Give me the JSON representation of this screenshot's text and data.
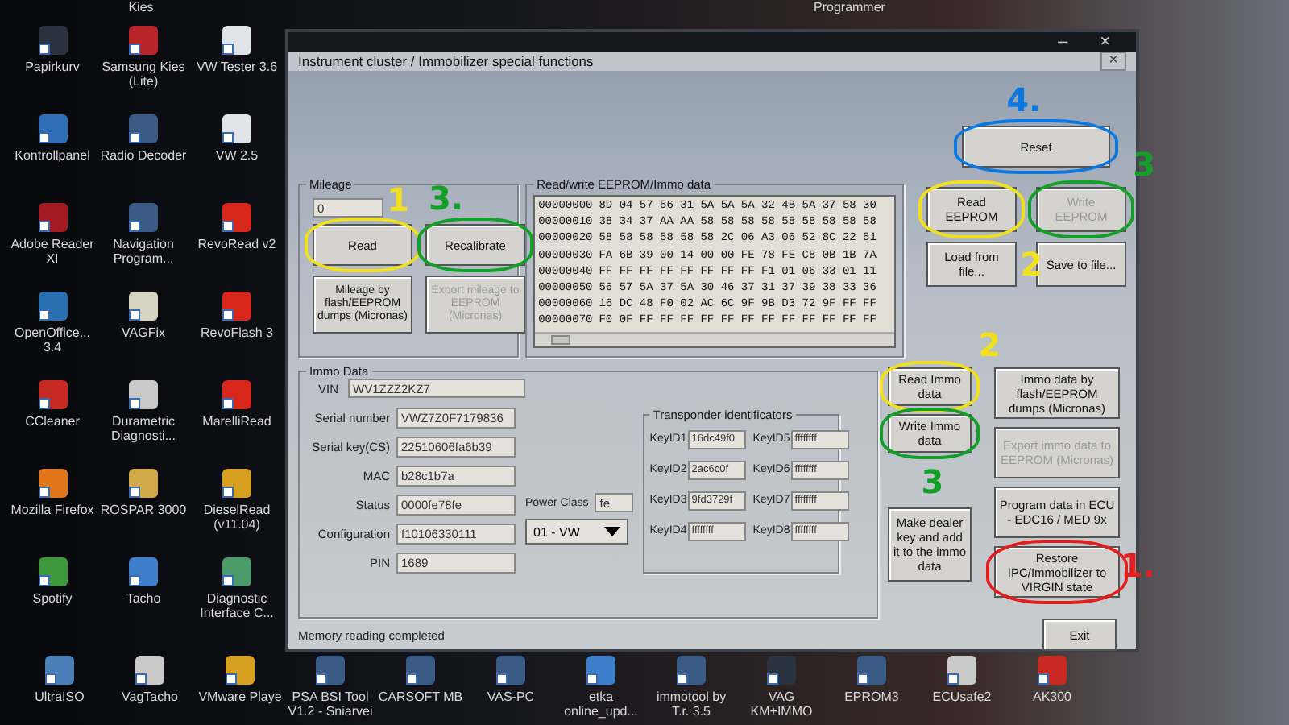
{
  "desktop": {
    "top_labels": [
      "Kies",
      "Programmer"
    ],
    "icons": [
      {
        "label": "Papirkurv",
        "color": "#2b3340"
      },
      {
        "label": "Samsung Kies (Lite)",
        "color": "#b8262c"
      },
      {
        "label": "VW Tester 3.6",
        "color": "#dfe4ea"
      },
      {
        "label": "Kontrollpanel",
        "color": "#2f6fb8"
      },
      {
        "label": "Radio Decoder",
        "color": "#3a5a86"
      },
      {
        "label": "VW 2.5",
        "color": "#dfe4ea"
      },
      {
        "label": "Adobe Reader XI",
        "color": "#a11c22"
      },
      {
        "label": "Navigation Program...",
        "color": "#3a5a86"
      },
      {
        "label": "RevoRead v2",
        "color": "#d8261c"
      },
      {
        "label": "OpenOffice... 3.4",
        "color": "#2a6fb0"
      },
      {
        "label": "VAGFix",
        "color": "#d8d2c0"
      },
      {
        "label": "RevoFlash 3",
        "color": "#d8261c"
      },
      {
        "label": "CCleaner",
        "color": "#c62a22"
      },
      {
        "label": "Durametric Diagnosti...",
        "color": "#c9c9c9"
      },
      {
        "label": "MarelliRead",
        "color": "#d8261c"
      },
      {
        "label": "Mozilla Firefox",
        "color": "#e0761c"
      },
      {
        "label": "ROSPAR 3000",
        "color": "#cfa94a"
      },
      {
        "label": "DieselRead (v11.04)",
        "color": "#d8a020"
      },
      {
        "label": "Spotify",
        "color": "#3c9a3c"
      },
      {
        "label": "Tacho",
        "color": "#3e7fc9"
      },
      {
        "label": "Diagnostic Interface C...",
        "color": "#4a9a6a"
      }
    ],
    "bottom_icons": [
      {
        "label": "UltraISO",
        "color": "#4a7fb8"
      },
      {
        "label": "VagTacho",
        "color": "#c9c9c9"
      },
      {
        "label": "VMware Playe",
        "color": "#d8a020"
      },
      {
        "label": "PSA BSI Tool V1.2 - Sniarvei",
        "color": "#3a5a86"
      },
      {
        "label": "CARSOFT MB",
        "color": "#3a5a86"
      },
      {
        "label": "VAS-PC",
        "color": "#3a5a86"
      },
      {
        "label": "etka online_upd...",
        "color": "#3e7fc9"
      },
      {
        "label": "immotool by T.r. 3.5",
        "color": "#3a5a86"
      },
      {
        "label": "VAG KM+IMMO",
        "color": "#2b3340"
      },
      {
        "label": "EPROM3",
        "color": "#3a5a86"
      },
      {
        "label": "ECUsafe2",
        "color": "#c9c9c9"
      },
      {
        "label": "AK300",
        "color": "#c62a22"
      }
    ]
  },
  "window": {
    "title": "Instrument cluster / Immobilizer special functions",
    "controls": [
      "–",
      "×"
    ],
    "close": "×"
  },
  "reset_button": {
    "label": "Reset",
    "circle": {
      "color": "#0a78e0"
    },
    "mark": {
      "text": "4.",
      "color": "#0a78e0"
    }
  },
  "mileage": {
    "title": "Mileage",
    "value": "0",
    "buttons": [
      {
        "label": "Read",
        "disabled": false,
        "circle": {
          "color": "#f0e020"
        },
        "mark": {
          "text": "1",
          "color": "#f0e020"
        }
      },
      {
        "label": "Recalibrate",
        "disabled": false,
        "circle": {
          "color": "#14a028"
        },
        "mark": {
          "text": "3.",
          "color": "#14a028"
        }
      },
      {
        "label": "Mileage by flash/EEPROM dumps (Micronas)",
        "disabled": false
      },
      {
        "label": "Export mileage to EEPROM (Micronas)",
        "disabled": true
      }
    ]
  },
  "eeprom": {
    "title": "Read/write EEPROM/Immo data",
    "rows": [
      {
        "address": "00000000",
        "bytes": "8D 04 57 56 31 5A 5A 5A 32 4B 5A 37 58 30"
      },
      {
        "address": "00000010",
        "bytes": "38 34 37 AA AA 58 58 58 58 58 58 58 58 58"
      },
      {
        "address": "00000020",
        "bytes": "58 58 58 58 58 58 2C 06 A3 06 52 8C 22 51"
      },
      {
        "address": "00000030",
        "bytes": "FA 6B 39 00 14 00 00 FE 78 FE C8 0B 1B 7A"
      },
      {
        "address": "00000040",
        "bytes": "FF FF FF FF FF FF FF FF F1 01 06 33 01 11"
      },
      {
        "address": "00000050",
        "bytes": "56 57 5A 37 5A 30 46 37 31 37 39 38 33 36"
      },
      {
        "address": "00000060",
        "bytes": "16 DC 48 F0 02 AC 6C 9F 9B D3 72 9F FF FF"
      },
      {
        "address": "00000070",
        "bytes": "F0 0F FF FF FF FF FF FF FF FF FF FF FF FF"
      }
    ],
    "buttons": [
      {
        "label": "Read EEPROM",
        "disabled": false,
        "circle": {
          "color": "#f0e020"
        }
      },
      {
        "label": "Write EEPROM",
        "disabled": true,
        "circle": {
          "color": "#14a028"
        },
        "mark": {
          "text": "3",
          "color": "#14a028"
        }
      },
      {
        "label": "Load from file...",
        "disabled": false,
        "mark": {
          "text": "2",
          "color": "#f0e020"
        }
      },
      {
        "label": "Save to file...",
        "disabled": false
      }
    ]
  },
  "immo": {
    "title": "Immo Data",
    "vin": {
      "label": "VIN",
      "value": "WV1ZZZ2KZ7"
    },
    "fields": [
      {
        "label": "Serial number",
        "value": "VWZ7Z0F7179836"
      },
      {
        "label": "Serial key(CS)",
        "value": "22510606fa6b39"
      },
      {
        "label": "MAC",
        "value": "b28c1b7a"
      },
      {
        "label": "Status",
        "value": "0000fe78fe"
      },
      {
        "label": "Configuration",
        "value": "f10106330111"
      },
      {
        "label": "PIN",
        "value": "1689"
      }
    ],
    "power_class": {
      "label": "Power Class",
      "value": "fe"
    },
    "dropdown": {
      "value": "01 - VW"
    },
    "transponder": {
      "title": "Transponder identificators",
      "keys": [
        {
          "label": "KeyID1",
          "value": "16dc49f0"
        },
        {
          "label": "KeyID2",
          "value": "2ac6c0f"
        },
        {
          "label": "KeyID3",
          "value": "9fd3729f"
        },
        {
          "label": "KeyID4",
          "value": "ffffffff"
        },
        {
          "label": "KeyID5",
          "value": "ffffffff"
        },
        {
          "label": "KeyID6",
          "value": "ffffffff"
        },
        {
          "label": "KeyID7",
          "value": "ffffffff"
        },
        {
          "label": "KeyID8",
          "value": "ffffffff"
        }
      ]
    }
  },
  "immo_buttons": {
    "left": [
      {
        "label": "Read Immo data",
        "disabled": false,
        "circle": {
          "color": "#f0e020"
        },
        "mark": {
          "text": "2",
          "color": "#f0e020"
        }
      },
      {
        "label": "Write Immo data",
        "disabled": false,
        "circle": {
          "color": "#14a028"
        },
        "mark": {
          "text": "3",
          "color": "#14a028"
        }
      },
      {
        "label": "Make dealer key and add it to the immo data",
        "disabled": false
      }
    ],
    "right": [
      {
        "label": "Immo data by flash/EEPROM dumps (Micronas)",
        "disabled": false
      },
      {
        "label": "Export immo data to EEPROM (Micronas)",
        "disabled": true
      },
      {
        "label": "Program data in ECU - EDC16 / MED 9x",
        "disabled": false
      },
      {
        "label": "Restore IPC/Immobilizer to VIRGIN state",
        "disabled": false,
        "circle": {
          "color": "#e02020"
        },
        "mark": {
          "text": "1.",
          "color": "#e02020"
        }
      }
    ]
  },
  "status_bar": {
    "text": "Memory reading completed"
  },
  "exit_button": {
    "label": "Exit"
  }
}
